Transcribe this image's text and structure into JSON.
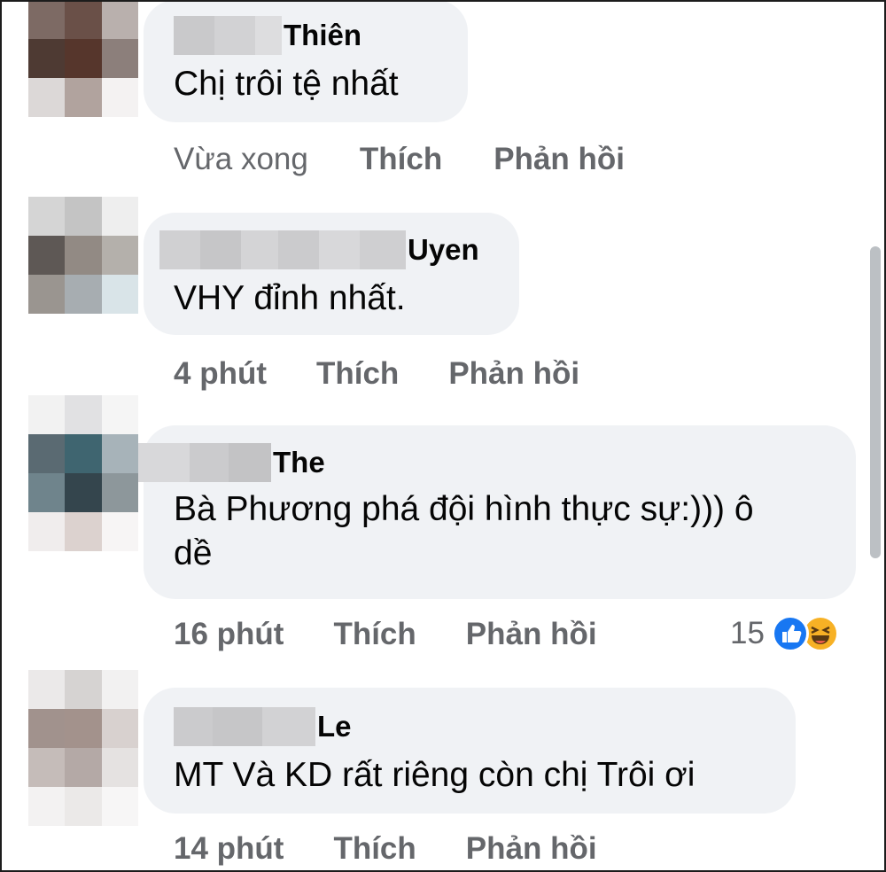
{
  "comments": [
    {
      "author": "Thiên",
      "text": "Chị trôi tệ nhất",
      "time": "Vừa xong",
      "like_label": "Thích",
      "reply_label": "Phản hồi"
    },
    {
      "author": "Uyen",
      "text": "VHY đỉnh nhất.",
      "time": "4 phút",
      "like_label": "Thích",
      "reply_label": "Phản hồi"
    },
    {
      "author": "The",
      "text": "Bà Phương phá đội hình thực sự:))) ô\ndề",
      "time": "16 phút",
      "like_label": "Thích",
      "reply_label": "Phản hồi",
      "reaction_count": "15",
      "reaction_icons": [
        "like-icon",
        "haha-icon"
      ]
    },
    {
      "author": "Le",
      "text": "MT Và KD rất riêng còn chị Trôi ơi",
      "time": "14 phút",
      "like_label": "Thích",
      "reply_label": "Phản hồi"
    }
  ],
  "colors": {
    "bubble": "#f0f2f5",
    "meta_text": "#65676b",
    "like_blue": "#1877f2",
    "haha_yellow": "#f7b125"
  }
}
